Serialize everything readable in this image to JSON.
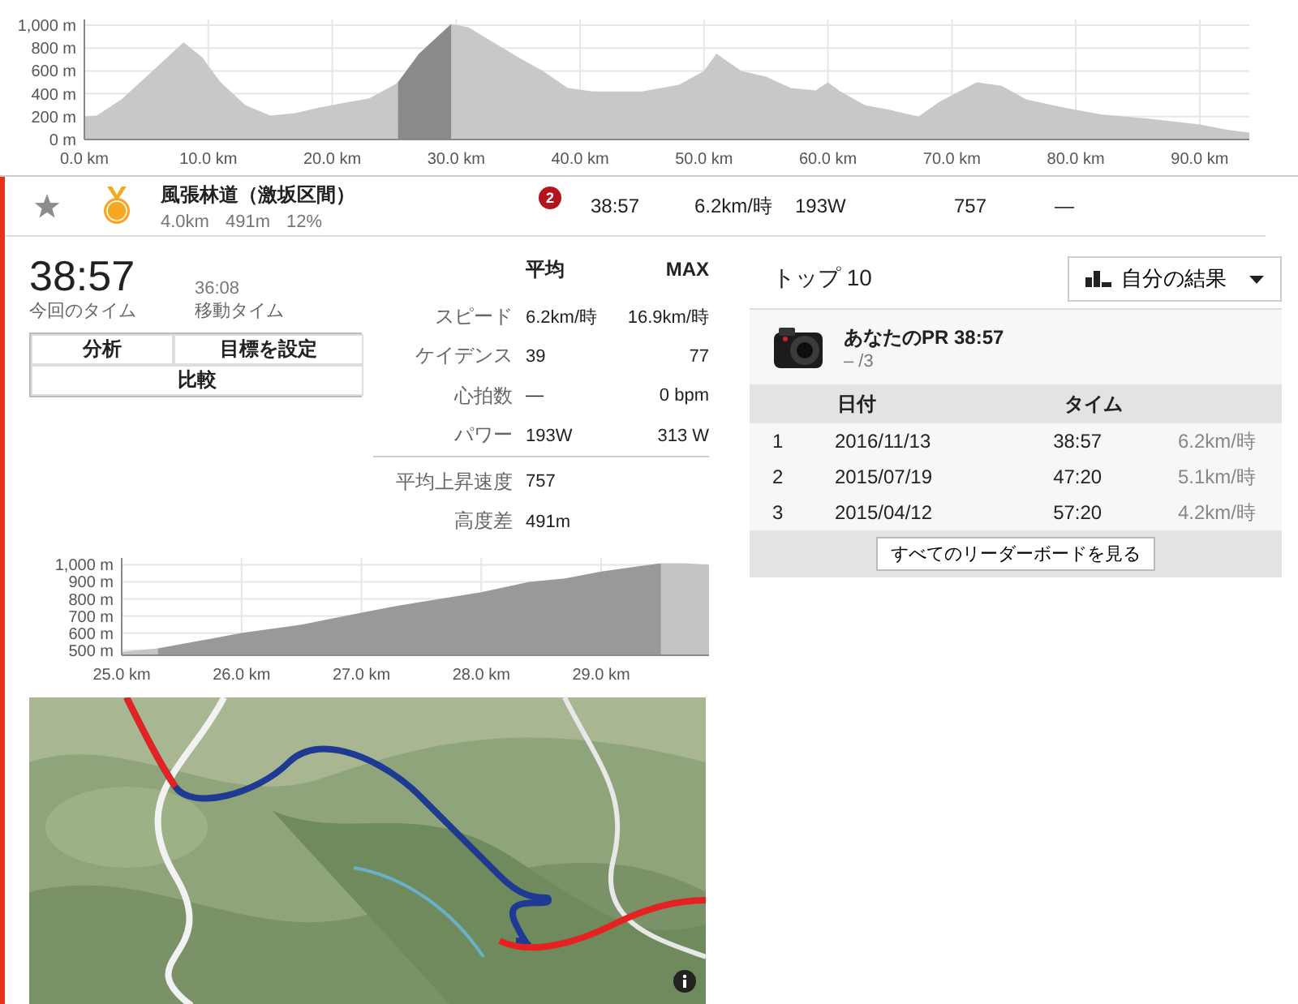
{
  "overview_chart": {
    "chart_data": {
      "type": "area",
      "grid": true,
      "x": [
        0,
        1,
        3,
        5,
        8,
        9.5,
        11,
        13,
        15,
        17,
        19,
        21,
        23,
        25,
        25.3,
        27,
        29.6,
        31,
        33,
        35,
        37,
        39,
        41,
        45,
        48,
        50,
        51,
        53,
        55,
        57,
        59,
        60,
        61,
        63,
        65,
        67.3,
        69,
        72,
        74,
        76,
        79,
        82,
        86,
        90,
        92,
        94
      ],
      "series": [
        {
          "color": "#c8c8c8",
          "values": [
            200,
            210,
            350,
            550,
            850,
            720,
            500,
            300,
            210,
            230,
            280,
            320,
            360,
            480,
            500,
            null,
            1010,
            980,
            850,
            720,
            600,
            450,
            420,
            420,
            480,
            600,
            750,
            600,
            550,
            450,
            430,
            500,
            420,
            300,
            260,
            200,
            330,
            500,
            470,
            350,
            280,
            220,
            180,
            130,
            90,
            60
          ]
        },
        {
          "color": "#8a8a8a",
          "values": [
            null,
            null,
            null,
            null,
            null,
            null,
            null,
            null,
            null,
            null,
            null,
            null,
            null,
            null,
            500,
            750,
            1010,
            null,
            null,
            null,
            null,
            null,
            null,
            null,
            null,
            null,
            null,
            null,
            null,
            null,
            null,
            null,
            null,
            null,
            null,
            null,
            null,
            null,
            null,
            null,
            null,
            null,
            null,
            null,
            null,
            null
          ]
        }
      ],
      "xlim": [
        0,
        94
      ],
      "ylim": [
        0,
        1050
      ],
      "xticks": [
        {
          "value": 0,
          "label": "0.0 km"
        },
        {
          "value": 10,
          "label": "10.0 km"
        },
        {
          "value": 20,
          "label": "20.0 km"
        },
        {
          "value": 30,
          "label": "30.0 km"
        },
        {
          "value": 40,
          "label": "40.0 km"
        },
        {
          "value": 50,
          "label": "50.0 km"
        },
        {
          "value": 60,
          "label": "60.0 km"
        },
        {
          "value": 70,
          "label": "70.0 km"
        },
        {
          "value": 80,
          "label": "80.0 km"
        },
        {
          "value": 90,
          "label": "90.0 km"
        }
      ],
      "yticks": [
        {
          "value": 0,
          "label": "0 m"
        },
        {
          "value": 200,
          "label": "200 m"
        },
        {
          "value": 400,
          "label": "400 m"
        },
        {
          "value": 600,
          "label": "600 m"
        },
        {
          "value": 800,
          "label": "800 m"
        },
        {
          "value": 1000,
          "label": "1,000 m"
        }
      ]
    }
  },
  "segment_row": {
    "starred": false,
    "has_pr": true,
    "name": "風張林道（激坂区間）",
    "distance": "4.0km",
    "elevation": "491m",
    "grade": "12%",
    "rank": "2",
    "time": "38:57",
    "speed": "6.2km/時",
    "power": "193W",
    "vam": "757",
    "heart_rate": "—"
  },
  "effort": {
    "time": "38:57",
    "time_label": "今回のタイム",
    "moving_time": "36:08",
    "moving_label": "移動タイム",
    "buttons": [
      "分析",
      "目標を設定",
      "比較"
    ]
  },
  "stats": {
    "headers": [
      "平均",
      "MAX"
    ],
    "rows": [
      {
        "label": "スピード",
        "avg": "6.2km/時",
        "max": "16.9km/時"
      },
      {
        "label": "ケイデンス",
        "avg": "39",
        "max": "77"
      },
      {
        "label": "心拍数",
        "avg": "—",
        "max": "0 bpm"
      },
      {
        "label": "パワー",
        "avg": "193W",
        "max": "313 W"
      }
    ],
    "extra": [
      {
        "label": "平均上昇速度",
        "value": "757"
      },
      {
        "label": "高度差",
        "value": "491m"
      }
    ]
  },
  "segment_chart": {
    "chart_data": {
      "type": "area",
      "grid": true,
      "x": [
        25,
        25.3,
        26,
        26.5,
        27,
        27.3,
        28,
        28.4,
        28.7,
        29,
        29.3,
        29.5,
        29.7,
        29.9
      ],
      "series": [
        {
          "color": "#c4c4c4",
          "values": [
            490,
            510,
            null,
            null,
            null,
            null,
            null,
            null,
            null,
            null,
            null,
            1010,
            1010,
            1000
          ]
        },
        {
          "color": "#999999",
          "values": [
            null,
            510,
            600,
            650,
            720,
            760,
            840,
            900,
            920,
            960,
            990,
            1010,
            null,
            null
          ]
        }
      ],
      "xlim": [
        25,
        29.9
      ],
      "ylim": [
        470,
        1040
      ],
      "xticks": [
        {
          "value": 25,
          "label": "25.0 km"
        },
        {
          "value": 26,
          "label": "26.0 km"
        },
        {
          "value": 27,
          "label": "27.0 km"
        },
        {
          "value": 28,
          "label": "28.0 km"
        },
        {
          "value": 29,
          "label": "29.0 km"
        }
      ],
      "yticks": [
        {
          "value": 500,
          "label": "500 m"
        },
        {
          "value": 600,
          "label": "600 m"
        },
        {
          "value": 700,
          "label": "700 m"
        },
        {
          "value": 800,
          "label": "800 m"
        },
        {
          "value": 900,
          "label": "900 m"
        },
        {
          "value": 1000,
          "label": "1,000 m"
        }
      ]
    }
  },
  "leaderboard": {
    "title": "トップ 10",
    "filter": "自分の結果",
    "pr_title": "あなたのPR 38:57",
    "pr_rank": "– /3",
    "columns": [
      "日付",
      "タイム"
    ],
    "rows": [
      {
        "rank": "1",
        "date": "2016/11/13",
        "time": "38:57",
        "speed": "6.2km/時"
      },
      {
        "rank": "2",
        "date": "2015/07/19",
        "time": "47:20",
        "speed": "5.1km/時"
      },
      {
        "rank": "3",
        "date": "2015/04/12",
        "time": "57:20",
        "speed": "4.2km/時"
      }
    ],
    "more_button": "すべてのリーダーボードを見る"
  }
}
